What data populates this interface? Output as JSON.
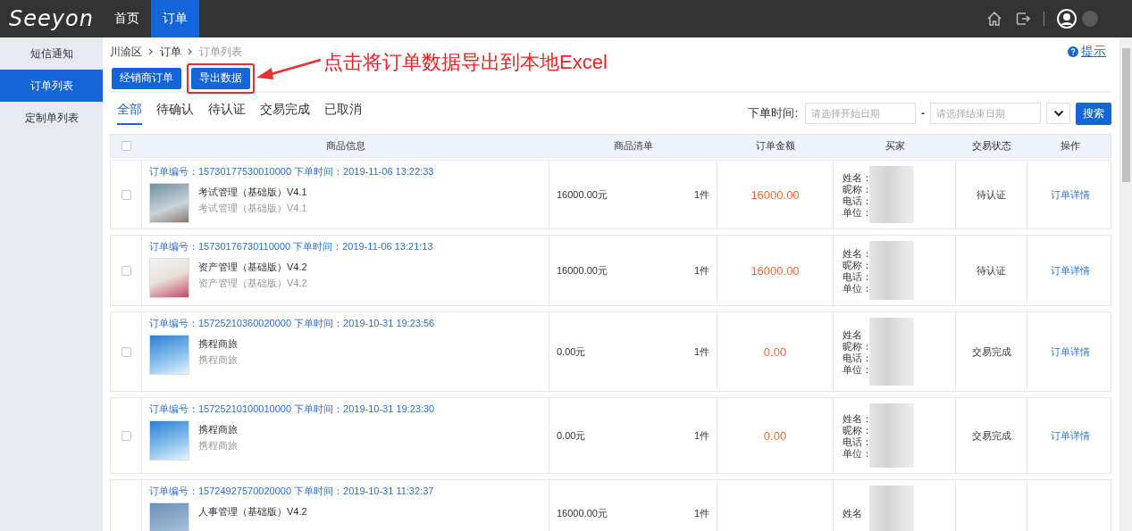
{
  "logo": "Seeyon",
  "top_nav": [
    {
      "label": "首页",
      "selected": false
    },
    {
      "label": "订单",
      "selected": true
    }
  ],
  "sidebar": {
    "items": [
      {
        "label": "短信通知",
        "selected": false
      },
      {
        "label": "订单列表",
        "selected": true
      },
      {
        "label": "定制单列表",
        "selected": false
      }
    ]
  },
  "breadcrumb": [
    "川渝区",
    "订单",
    "订单列表"
  ],
  "hint_link": "提示",
  "action_buttons": [
    {
      "label": "经销商订单",
      "highlighted": false
    },
    {
      "label": "导出数据",
      "highlighted": true
    }
  ],
  "annotation": "点击将订单数据导出到本地Excel",
  "tabs": [
    {
      "label": "全部",
      "selected": true
    },
    {
      "label": "待确认",
      "selected": false
    },
    {
      "label": "待认证",
      "selected": false
    },
    {
      "label": "交易完成",
      "selected": false
    },
    {
      "label": "已取消",
      "selected": false
    }
  ],
  "filter": {
    "label": "下单时间:",
    "start": {
      "placeholder": "请选择开始日期"
    },
    "separator": "-",
    "end": {
      "placeholder": "请选择结束日期"
    },
    "search_button": "搜索"
  },
  "table": {
    "header_checked": false,
    "columns": [
      "商品信息",
      "商品清单",
      "订单金额",
      "买家",
      "交易状态",
      "操作"
    ],
    "rows": [
      {
        "checked": false,
        "order_line": "订单编号：15730177530010000 下单时间：2019-11-06 13:22:33",
        "product_name": "考试管理（基础版）V4.1",
        "product_subtitle": "考试管理（基础版）V4.1",
        "price": "16000.00元",
        "quantity": "1件",
        "amount": "16000.00",
        "buyer_labels": [
          "姓名：",
          "昵称：",
          "电话：",
          "单位："
        ],
        "status": "待认证",
        "action": "订单详情"
      },
      {
        "checked": false,
        "order_line": "订单编号：15730176730110000 下单时间：2019-11-06 13:21:13",
        "product_name": "资产管理（基础版）V4.2",
        "product_subtitle": "资产管理（基础版）V4.2",
        "price": "16000.00元",
        "quantity": "1件",
        "amount": "16000.00",
        "buyer_labels": [
          "姓名：",
          "昵称：",
          "电话：",
          "单位："
        ],
        "status": "待认证",
        "action": "订单详情"
      },
      {
        "checked": false,
        "order_line": "订单编号：15725210360020000 下单时间：2019-10-31 19:23:56",
        "product_name": "携程商旅",
        "product_subtitle": "携程商旅",
        "price": "0.00元",
        "quantity": "1件",
        "amount": "0.00",
        "buyer_labels": [
          "姓名",
          "昵称：",
          "电话：",
          "单位："
        ],
        "status": "交易完成",
        "action": "订单详情"
      },
      {
        "checked": false,
        "order_line": "订单编号：15725210100010000 下单时间：2019-10-31 19:23:30",
        "product_name": "携程商旅",
        "product_subtitle": "携程商旅",
        "price": "0.00元",
        "quantity": "1件",
        "amount": "0.00",
        "buyer_labels": [
          "姓名：",
          "昵称：",
          "电话：",
          "单位："
        ],
        "status": "交易完成",
        "action": "订单详情"
      },
      {
        "order_line": "订单编号：15724927570020000 下单时间：2019-10-31 11:32:37",
        "product_name": "人事管理（基础版）V4.2",
        "price": "16000.00元",
        "quantity": "1件",
        "buyer_labels": [
          "姓名"
        ]
      }
    ]
  }
}
